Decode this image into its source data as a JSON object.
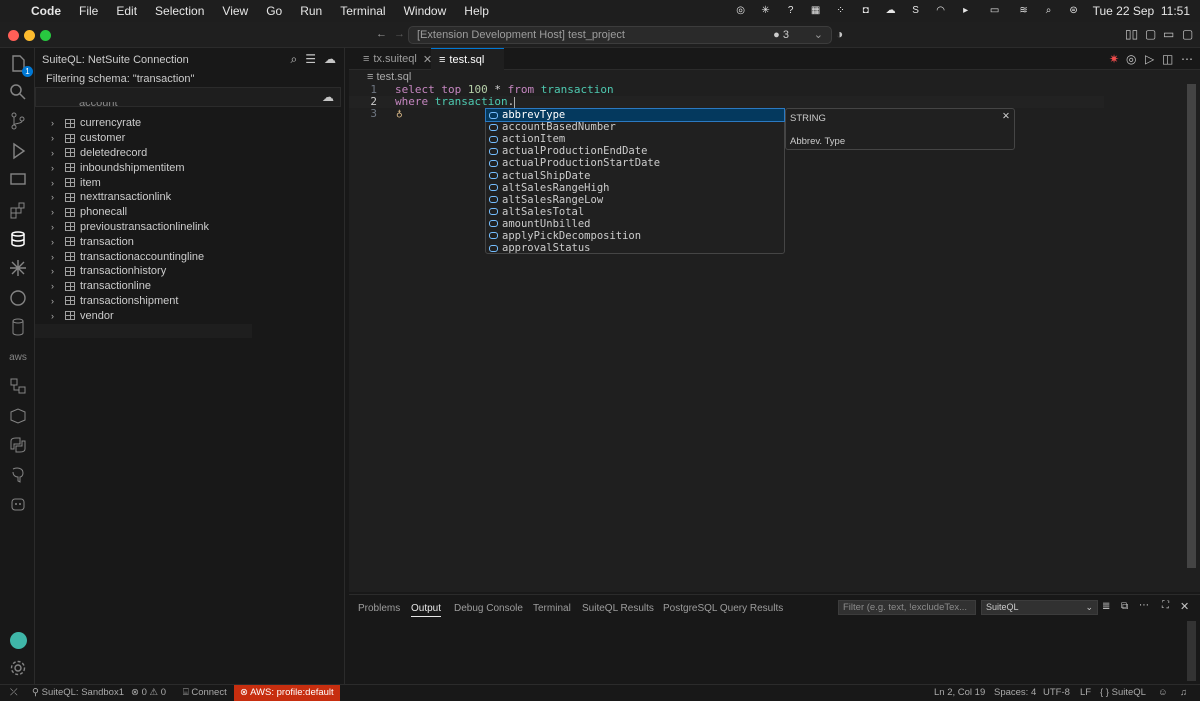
{
  "menubar": {
    "app": "Code",
    "items": [
      "File",
      "Edit",
      "Selection",
      "View",
      "Go",
      "Run",
      "Terminal",
      "Window",
      "Help"
    ],
    "clock": "Tue 22 Sep  11:51"
  },
  "titlebar": {
    "command_center": "[Extension Development Host] test_project",
    "badge_count": "3"
  },
  "activity": {
    "badge": "1"
  },
  "sidebar": {
    "title": "SuiteQL: NetSuite Connection",
    "filter": "Filtering schema: \"transaction\"",
    "partial_item": "account",
    "items": [
      "currencyrate",
      "customer",
      "deletedrecord",
      "inboundshipmentitem",
      "item",
      "nexttransactionlink",
      "phonecall",
      "previoustransactionlinelink",
      "transaction",
      "transactionaccountingline",
      "transactionhistory",
      "transactionline",
      "transactionshipment",
      "vendor"
    ]
  },
  "editor": {
    "tabs": [
      {
        "label": "tx.suiteql"
      },
      {
        "label": "test.sql"
      }
    ],
    "breadcrumb": "test.sql",
    "line_numbers": [
      "1",
      "2",
      "3"
    ],
    "line1": {
      "k1": "select",
      "k2": "top",
      "num": "100",
      "star": "*",
      "k3": "from",
      "tbl": "transaction"
    },
    "line2": {
      "k1": "where",
      "obj": "transaction",
      "dot": "."
    }
  },
  "suggest": {
    "items": [
      "abbrevType",
      "accountBasedNumber",
      "actionItem",
      "actualProductionEndDate",
      "actualProductionStartDate",
      "actualShipDate",
      "altSalesRangeHigh",
      "altSalesRangeLow",
      "altSalesTotal",
      "amountUnbilled",
      "applyPickDecomposition",
      "approvalStatus"
    ],
    "detail_type": "STRING",
    "detail_desc": "Abbrev. Type"
  },
  "panel": {
    "tabs": [
      "Problems",
      "Output",
      "Debug Console",
      "Terminal",
      "SuiteQL Results",
      "PostgreSQL Query Results"
    ],
    "active_tab": "Output",
    "filter_placeholder": "Filter (e.g. text, !excludeTex...",
    "channel": "SuiteQL"
  },
  "status": {
    "connection": "SuiteQL: Sandbox1",
    "errors": "0",
    "warnings": "0",
    "connect": "Connect",
    "aws": "AWS: profile:default",
    "position": "Ln 2, Col 19",
    "spaces": "Spaces: 4",
    "encoding": "UTF-8",
    "eol": "LF",
    "language": "{ } SuiteQL"
  },
  "colors": {
    "accent": "#0078d4",
    "aws_badge": "#c72e0f",
    "selection": "#04395e"
  }
}
